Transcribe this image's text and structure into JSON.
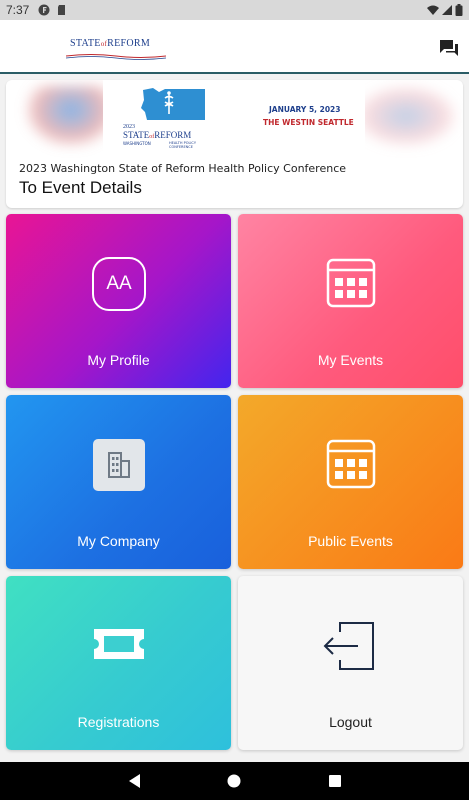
{
  "status_bar": {
    "time": "7:37",
    "icons": [
      "notification-f-icon",
      "sd-card-icon",
      "wifi-icon",
      "signal-icon",
      "battery-icon"
    ]
  },
  "app_bar": {
    "logo": {
      "pre": "STATE",
      "mid": "of",
      "post": "REFORM"
    },
    "action_icon": "chat-icon"
  },
  "event_card": {
    "banner": {
      "year": "2023",
      "brand_pre": "STATE",
      "brand_mid": "of",
      "brand_post": "REFORM",
      "state": "WASHINGTON",
      "sub_line_1": "HEALTH POLICY",
      "sub_line_2": "CONFERENCE",
      "date": "JANUARY 5, 2023",
      "venue": "THE WESTIN SEATTLE"
    },
    "title": "2023 Washington State of Reform Health Policy Conference",
    "link_label": "To Event Details"
  },
  "tiles": {
    "profile": {
      "label": "My Profile",
      "avatar_initials": "AA",
      "icon": "avatar-icon"
    },
    "events": {
      "label": "My Events",
      "icon": "calendar-grid-icon"
    },
    "company": {
      "label": "My Company",
      "icon": "building-icon"
    },
    "public_events": {
      "label": "Public Events",
      "icon": "calendar-grid-icon"
    },
    "registrations": {
      "label": "Registrations",
      "icon": "ticket-icon"
    },
    "logout": {
      "label": "Logout",
      "icon": "logout-icon"
    }
  },
  "colors": {
    "profile_gradient": [
      "#e91594",
      "#4325ee"
    ],
    "events_gradient": [
      "#ff84a3",
      "#ff4e6a"
    ],
    "company_gradient": [
      "#2296f0",
      "#1960dc"
    ],
    "public_gradient": [
      "#f3a92a",
      "#fa7a16"
    ],
    "registrations_gradient": [
      "#40e0c2",
      "#2ec0dc"
    ],
    "logout_bg": "#f7f7f7",
    "brand_blue": "#1e3f8c",
    "brand_red": "#c0282d"
  },
  "nav_bar": {
    "icons": [
      "back-icon",
      "home-icon",
      "recents-icon"
    ]
  }
}
